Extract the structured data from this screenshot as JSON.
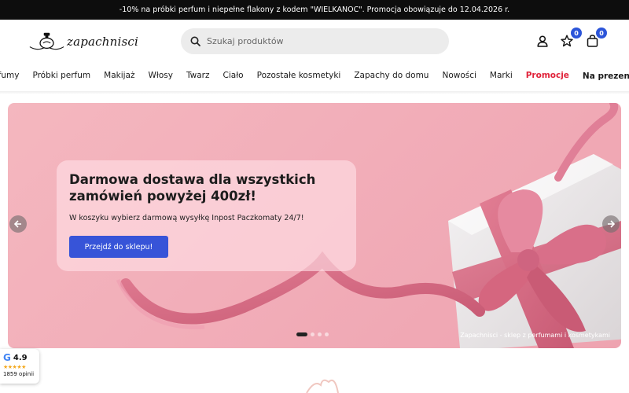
{
  "promo_bar": {
    "text": "-10% na próbki perfum i niepełne flakony z kodem \"WIELKANOC\". Promocja obowiązuje do 12.04.2026 r."
  },
  "header": {
    "logo_text": "zapachnisci",
    "search": {
      "placeholder": "Szukaj produktów",
      "value": ""
    },
    "wishlist_count": "0",
    "cart_count": "0"
  },
  "nav": {
    "items": [
      {
        "label": "Perfumy"
      },
      {
        "label": "Próbki perfum"
      },
      {
        "label": "Makijaż"
      },
      {
        "label": "Włosy"
      },
      {
        "label": "Twarz"
      },
      {
        "label": "Ciało"
      },
      {
        "label": "Pozostałe kosmetyki"
      },
      {
        "label": "Zapachy do domu"
      },
      {
        "label": "Nowości"
      },
      {
        "label": "Marki"
      },
      {
        "label": "Promocje"
      },
      {
        "label": "Na prezent🎁"
      }
    ]
  },
  "hero": {
    "title": "Darmowa dostawa dla wszystkich zamówień powyżej 400zł!",
    "text": "W koszyku wybierz darmową wysyłkę Inpost Paczkomaty 24/7!",
    "button_label": "Przejdź do sklepu!",
    "caption": "Zapachnisci - sklep z perfumami i kosmetykami",
    "slides_total": 4,
    "active_slide": 1
  },
  "rating": {
    "score": "4.9",
    "stars": "★★★★★",
    "count": "1859 opinii",
    "logo_letter": "G"
  },
  "icons": {
    "search": "search-icon",
    "account": "user-icon",
    "wishlist": "star-icon",
    "cart": "bag-icon",
    "prev": "arrow-left-icon",
    "next": "arrow-right-icon"
  },
  "colors": {
    "accent": "#3754d8",
    "promo": "#e0233a",
    "badge": "#2c55d9",
    "hero_bg": "#f2aeb9"
  }
}
